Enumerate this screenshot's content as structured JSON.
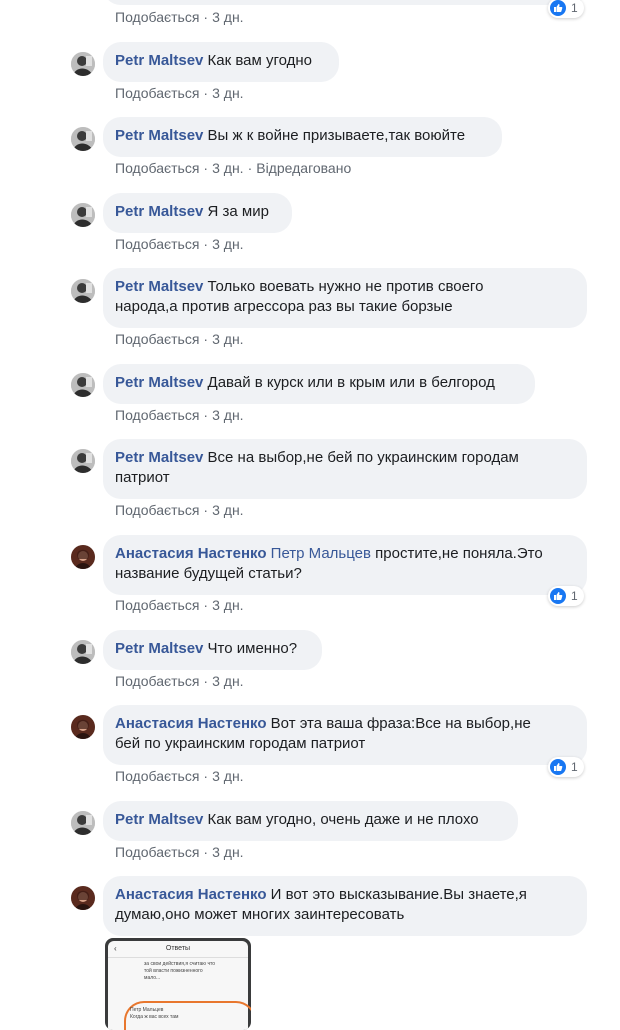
{
  "top": {
    "meta_like": "Подобається",
    "meta_time": "3 дн.",
    "reaction_count": "1"
  },
  "comments": [
    {
      "author": "Petr Maltsev",
      "mention": "",
      "text": "Как вам угодно",
      "like": "Подобається",
      "time": "3 дн.",
      "edited": "",
      "reactions": ""
    },
    {
      "author": "Petr Maltsev",
      "mention": "",
      "text": "Вы ж к войне призываете,так воюйте",
      "like": "Подобається",
      "time": "3 дн.",
      "edited": "Відредаговано",
      "reactions": ""
    },
    {
      "author": "Petr Maltsev",
      "mention": "",
      "text": "Я за мир",
      "like": "Подобається",
      "time": "3 дн.",
      "edited": "",
      "reactions": ""
    },
    {
      "author": "Petr Maltsev",
      "mention": "",
      "text_lines": [
        "Только воевать нужно не против своего",
        "народа,а против агрессора раз вы такие борзые"
      ],
      "like": "Подобається",
      "time": "3 дн.",
      "edited": "",
      "reactions": ""
    },
    {
      "author": "Petr Maltsev",
      "mention": "",
      "text": "Давай в курск или в крым или в белгород",
      "like": "Подобається",
      "time": "3 дн.",
      "edited": "",
      "reactions": ""
    },
    {
      "author": "Petr Maltsev",
      "mention": "",
      "text_lines": [
        "Все на выбор,не бей по украинским городам",
        "патриот"
      ],
      "like": "Подобається",
      "time": "3 дн.",
      "edited": "",
      "reactions": ""
    },
    {
      "author": "Анастасия Настенко",
      "mention": "Петр Мальцев",
      "text_lines": [
        "простите,не поняла.Это",
        "название будущей статьи?"
      ],
      "like": "Подобається",
      "time": "3 дн.",
      "edited": "",
      "reactions": "1"
    },
    {
      "author": "Petr Maltsev",
      "mention": "",
      "text": "Что именно?",
      "like": "Подобається",
      "time": "3 дн.",
      "edited": "",
      "reactions": ""
    },
    {
      "author": "Анастасия Настенко",
      "mention": "",
      "text_lines": [
        "Вот эта ваша фраза:Все на выбор,не",
        "бей по украинским городам патриот"
      ],
      "like": "Подобається",
      "time": "3 дн.",
      "edited": "",
      "reactions": "1"
    },
    {
      "author": "Petr Maltsev",
      "mention": "",
      "text": "Как вам угодно, очень даже и не плохо",
      "like": "Подобається",
      "time": "3 дн.",
      "edited": "",
      "reactions": ""
    },
    {
      "author": "Анастасия Настенко",
      "mention": "",
      "text_lines": [
        "И вот это высказывание.Вы знаете,я",
        "думаю,оно может многих заинтересовать"
      ],
      "like": "",
      "time": "",
      "edited": "",
      "reactions": ""
    }
  ],
  "attachment": {
    "header": "Ответы",
    "lines": [
      "за свои действия,я считаю что",
      "той власти пожизненного",
      "мало...",
      "Петр Мальцев",
      "Когда ж вас всех там"
    ]
  },
  "colors": {
    "bubble": "#f0f2f5",
    "author": "#385898",
    "meta": "#606770",
    "like_badge": "#1877f2"
  }
}
